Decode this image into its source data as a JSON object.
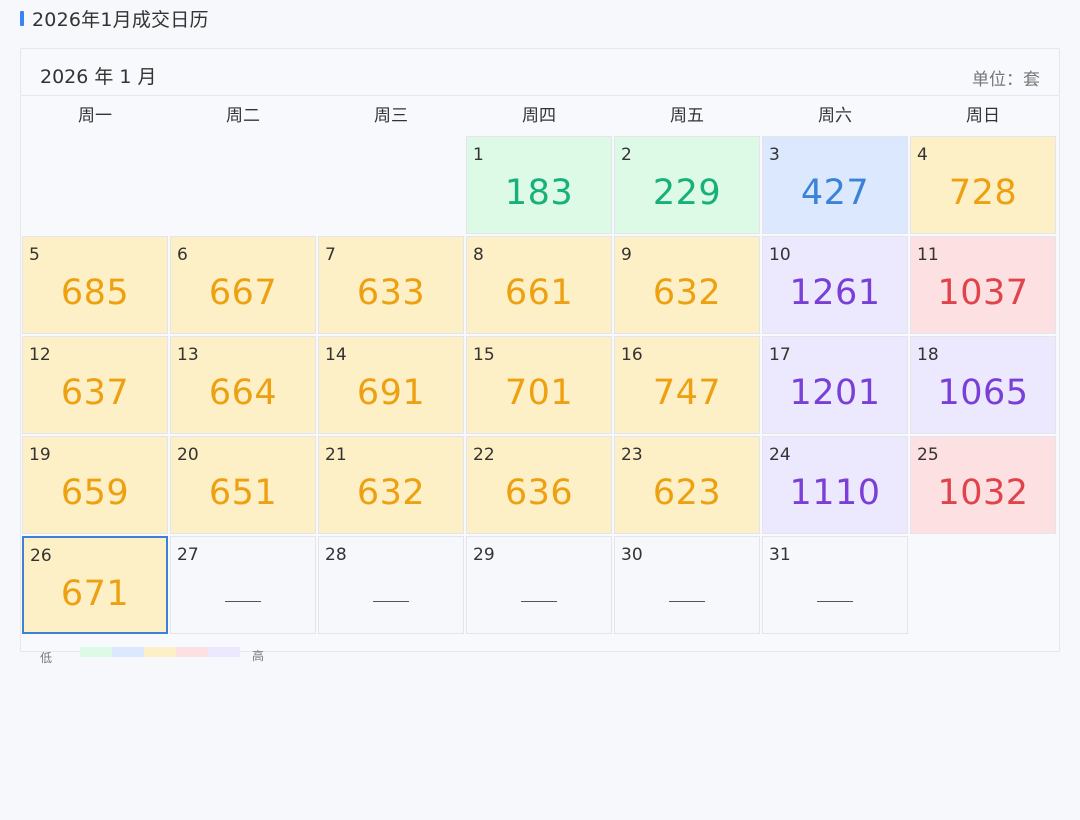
{
  "page": {
    "title": "2026年1月成交日历",
    "month_label": "2026 年 1 月",
    "unit_label": "单位：套"
  },
  "weekdays": [
    "周一",
    "周二",
    "周三",
    "周四",
    "周五",
    "周六",
    "周日"
  ],
  "leading_blank_days": 3,
  "days": [
    {
      "day": "1",
      "value": "183",
      "level": "green"
    },
    {
      "day": "2",
      "value": "229",
      "level": "green"
    },
    {
      "day": "3",
      "value": "427",
      "level": "blue"
    },
    {
      "day": "4",
      "value": "728",
      "level": "yellow"
    },
    {
      "day": "5",
      "value": "685",
      "level": "yellow"
    },
    {
      "day": "6",
      "value": "667",
      "level": "yellow"
    },
    {
      "day": "7",
      "value": "633",
      "level": "yellow"
    },
    {
      "day": "8",
      "value": "661",
      "level": "yellow"
    },
    {
      "day": "9",
      "value": "632",
      "level": "yellow"
    },
    {
      "day": "10",
      "value": "1261",
      "level": "purple"
    },
    {
      "day": "11",
      "value": "1037",
      "level": "red"
    },
    {
      "day": "12",
      "value": "637",
      "level": "yellow"
    },
    {
      "day": "13",
      "value": "664",
      "level": "yellow"
    },
    {
      "day": "14",
      "value": "691",
      "level": "yellow"
    },
    {
      "day": "15",
      "value": "701",
      "level": "yellow"
    },
    {
      "day": "16",
      "value": "747",
      "level": "yellow"
    },
    {
      "day": "17",
      "value": "1201",
      "level": "purple"
    },
    {
      "day": "18",
      "value": "1065",
      "level": "purple"
    },
    {
      "day": "19",
      "value": "659",
      "level": "yellow"
    },
    {
      "day": "20",
      "value": "651",
      "level": "yellow"
    },
    {
      "day": "21",
      "value": "632",
      "level": "yellow"
    },
    {
      "day": "22",
      "value": "636",
      "level": "yellow"
    },
    {
      "day": "23",
      "value": "623",
      "level": "yellow"
    },
    {
      "day": "24",
      "value": "1110",
      "level": "purple"
    },
    {
      "day": "25",
      "value": "1032",
      "level": "red"
    },
    {
      "day": "26",
      "value": "671",
      "level": "yellow",
      "selected": true
    },
    {
      "day": "27",
      "value": null,
      "level": "none"
    },
    {
      "day": "28",
      "value": null,
      "level": "none"
    },
    {
      "day": "29",
      "value": null,
      "level": "none"
    },
    {
      "day": "30",
      "value": null,
      "level": "none"
    },
    {
      "day": "31",
      "value": null,
      "level": "none"
    }
  ],
  "legend": {
    "low_label": "低",
    "high_label": "高",
    "swatches": [
      "#ddfae6",
      "#dbe8fd",
      "#fdf0c6",
      "#fde0e2",
      "#ece8fd"
    ]
  },
  "colors": {
    "accent": "#3b82f6",
    "green": "#16b07a",
    "blue": "#3b82d9",
    "yellow": "#eda112",
    "red": "#e0434b",
    "purple": "#7a3fd6"
  }
}
